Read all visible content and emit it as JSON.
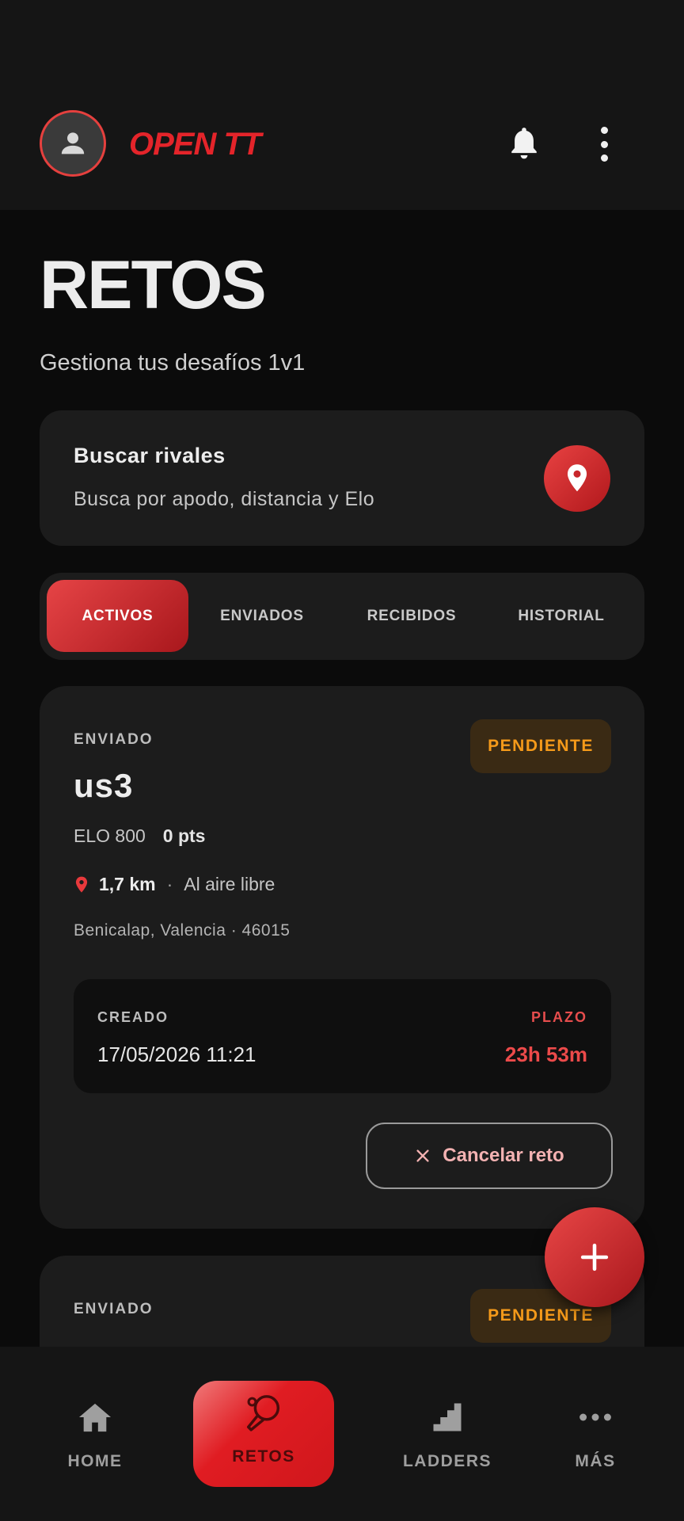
{
  "header": {
    "brand": "OPEN TT",
    "icons": [
      "avatar-icon",
      "bell-icon",
      "more-vertical-icon"
    ]
  },
  "page": {
    "title": "RETOS",
    "subtitle": "Gestiona tus desafíos 1v1"
  },
  "search": {
    "title": "Buscar rivales",
    "description": "Busca por apodo, distancia y Elo",
    "icon": "location-pin-icon"
  },
  "tabs": [
    {
      "label": "ACTIVOS",
      "active": true
    },
    {
      "label": "ENVIADOS",
      "active": false
    },
    {
      "label": "RECIBIDOS",
      "active": false
    },
    {
      "label": "HISTORIAL",
      "active": false
    }
  ],
  "challenges": [
    {
      "type": "ENVIADO",
      "status": "PENDIENTE",
      "opponent": "us3",
      "elo": "ELO 800",
      "points": "0 pts",
      "distance": "1,7 km",
      "separator": "·",
      "venue": "Al aire libre",
      "address": "Benicalap, Valencia · 46015",
      "created_label": "CREADO",
      "created_value": "17/05/2026 11:21",
      "deadline_label": "PLAZO",
      "deadline_value": "23h 53m",
      "cancel_label": "Cancelar reto"
    },
    {
      "type": "ENVIADO",
      "status": "PENDIENTE"
    }
  ],
  "fab": {
    "icon": "plus-icon"
  },
  "bottom_nav": [
    {
      "label": "HOME",
      "icon": "home-icon"
    },
    {
      "label": "RETOS",
      "icon": "ping-pong-paddle-icon",
      "active": true
    },
    {
      "label": "LADDERS",
      "icon": "stairs-icon"
    },
    {
      "label": "MÁS",
      "icon": "more-horizontal-icon"
    }
  ],
  "colors": {
    "accent": "#e4242a",
    "pending": "#f59a1a",
    "deadline": "#ec4a4a",
    "card": "#1c1c1c",
    "background": "#0b0b0b"
  }
}
